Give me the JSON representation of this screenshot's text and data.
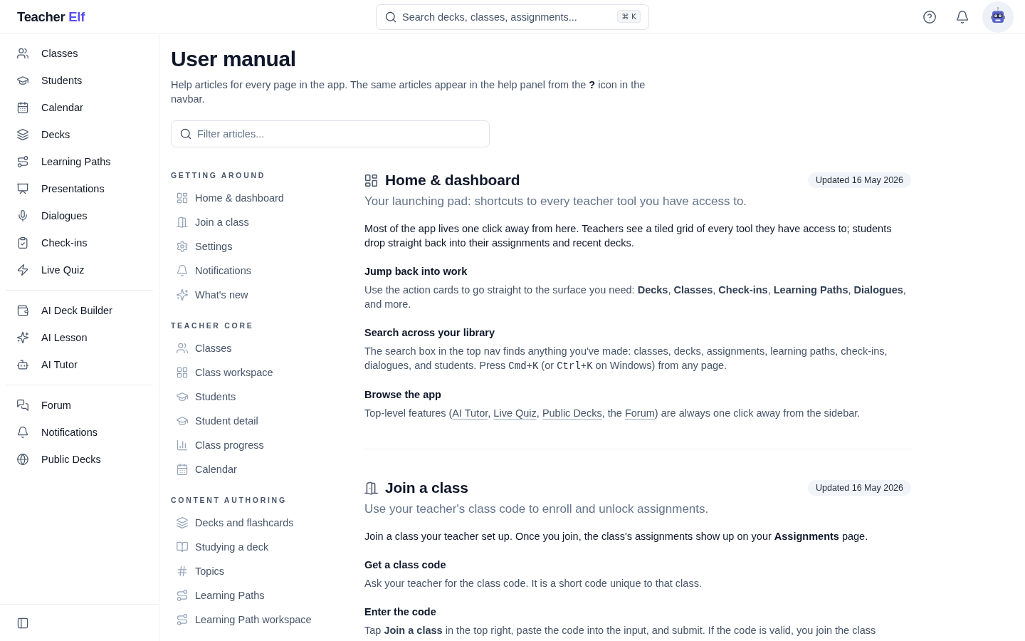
{
  "topbar": {
    "logo": {
      "text": "Teacher",
      "accent": "Elf"
    },
    "search": {
      "placeholder": "Search decks, classes, assignments...",
      "shortcut": "⌘ K"
    }
  },
  "sidebar": {
    "groups": [
      {
        "items": [
          {
            "label": "Classes"
          },
          {
            "label": "Students"
          },
          {
            "label": "Calendar"
          },
          {
            "label": "Decks"
          },
          {
            "label": "Learning Paths"
          },
          {
            "label": "Presentations"
          },
          {
            "label": "Dialogues"
          },
          {
            "label": "Check-ins"
          },
          {
            "label": "Live Quiz"
          }
        ]
      },
      {
        "items": [
          {
            "label": "AI Deck Builder"
          },
          {
            "label": "AI Lesson"
          },
          {
            "label": "AI Tutor"
          }
        ]
      },
      {
        "items": [
          {
            "label": "Forum"
          },
          {
            "label": "Notifications"
          },
          {
            "label": "Public Decks"
          }
        ]
      }
    ]
  },
  "page": {
    "title": "User manual",
    "description": "Help articles for every page in the app. The same articles appear in the help panel from the **?** icon in the navbar.",
    "filter": {
      "placeholder": "Filter articles..."
    }
  },
  "article_nav": {
    "sections": [
      {
        "heading": "GETTING AROUND",
        "items": [
          {
            "label": "Home & dashboard"
          },
          {
            "label": "Join a class"
          },
          {
            "label": "Settings"
          },
          {
            "label": "Notifications"
          },
          {
            "label": "What's new"
          }
        ]
      },
      {
        "heading": "TEACHER CORE",
        "items": [
          {
            "label": "Classes"
          },
          {
            "label": "Class workspace"
          },
          {
            "label": "Students"
          },
          {
            "label": "Student detail"
          },
          {
            "label": "Class progress"
          },
          {
            "label": "Calendar"
          }
        ]
      },
      {
        "heading": "CONTENT AUTHORING",
        "items": [
          {
            "label": "Decks and flashcards"
          },
          {
            "label": "Studying a deck"
          },
          {
            "label": "Topics"
          },
          {
            "label": "Learning Paths"
          },
          {
            "label": "Learning Path workspace"
          }
        ]
      }
    ]
  },
  "articles": [
    {
      "title": "Home & dashboard",
      "updated": "Updated 16 May 2026",
      "subtitle": "Your launching pad: shortcuts to every teacher tool you have access to.",
      "intro": [
        {
          "kind": "text",
          "text": "Most of the app lives one click away from here. Teachers see a tiled grid of every tool they have access to; students drop straight back into their assignments and recent decks."
        }
      ],
      "sections": [
        {
          "heading": "Jump back into work",
          "body": [
            {
              "kind": "text",
              "text": "Use the action cards to go straight to the surface you need: **Decks**, **Classes**, **Check-ins**, **Learning Paths**, **Dialogues**, and more."
            }
          ]
        },
        {
          "heading": "Search across your library",
          "body": [
            {
              "kind": "text",
              "text": "The search box in the top nav finds anything you've made: classes, decks, assignments, learning paths, check-ins, dialogues, and students. Press "
            },
            {
              "kind": "code",
              "text": "Cmd+K"
            },
            {
              "kind": "text",
              "text": " (or "
            },
            {
              "kind": "code",
              "text": "Ctrl+K"
            },
            {
              "kind": "text",
              "text": " on Windows) from any page."
            }
          ]
        },
        {
          "heading": "Browse the app",
          "body": [
            {
              "kind": "text",
              "text": "Top-level features ("
            },
            {
              "kind": "link",
              "text": "AI Tutor"
            },
            {
              "kind": "text",
              "text": ", "
            },
            {
              "kind": "link",
              "text": "Live Quiz"
            },
            {
              "kind": "text",
              "text": ", "
            },
            {
              "kind": "link",
              "text": "Public Decks"
            },
            {
              "kind": "text",
              "text": ", the "
            },
            {
              "kind": "link",
              "text": "Forum"
            },
            {
              "kind": "text",
              "text": ") are always one click away from the sidebar."
            }
          ]
        }
      ]
    },
    {
      "title": "Join a class",
      "updated": "Updated 16 May 2026",
      "subtitle": "Use your teacher's class code to enroll and unlock assignments.",
      "intro": [
        {
          "kind": "text",
          "text": "Join a class your teacher set up. Once you join, the class's assignments show up on your **Assignments** page."
        }
      ],
      "sections": [
        {
          "heading": "Get a class code",
          "body": [
            {
              "kind": "text",
              "text": "Ask your teacher for the class code. It is a short code unique to that class."
            }
          ]
        },
        {
          "heading": "Enter the code",
          "body": [
            {
              "kind": "text",
              "text": "Tap **Join a class** in the top right, paste the code into the input, and submit. If the code is valid, you join the class"
            }
          ]
        }
      ]
    }
  ]
}
